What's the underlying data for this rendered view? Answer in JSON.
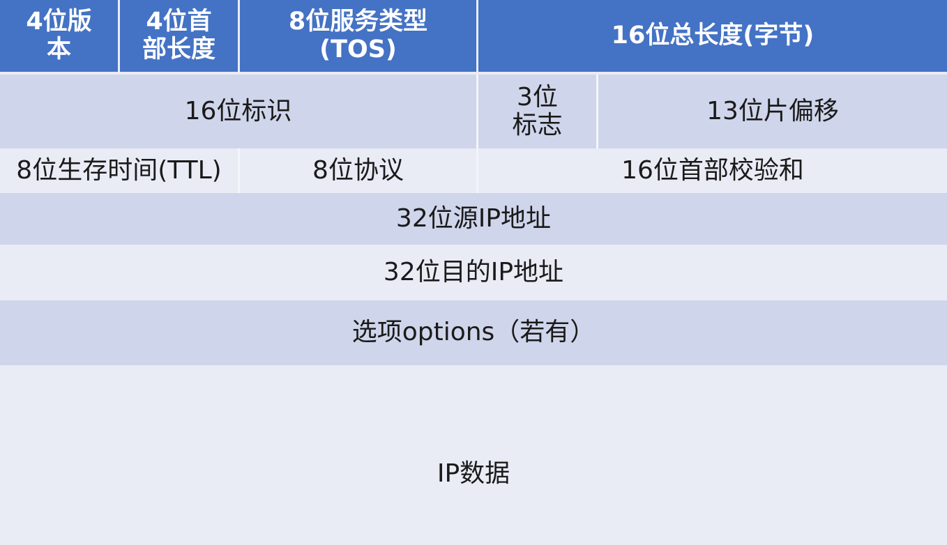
{
  "header": {
    "version": "4位版\n本",
    "header_length": "4位首\n部长度",
    "tos": "8位服务类型\n(TOS)",
    "total_length": "16位总长度(字节)"
  },
  "row2": {
    "identification": "16位标识",
    "flags": "3位\n标志",
    "fragment_offset": "13位片偏移"
  },
  "row3": {
    "ttl": "8位生存时间(TTL)",
    "protocol": "8位协议",
    "checksum": "16位首部校验和"
  },
  "source_ip": "32位源IP地址",
  "dest_ip": "32位目的IP地址",
  "options": "选项options（若有）",
  "ip_data": "IP数据",
  "colors": {
    "header_bg": "#4472c4",
    "row_dark": "#cfd5ea",
    "row_light": "#e9ebf5"
  }
}
